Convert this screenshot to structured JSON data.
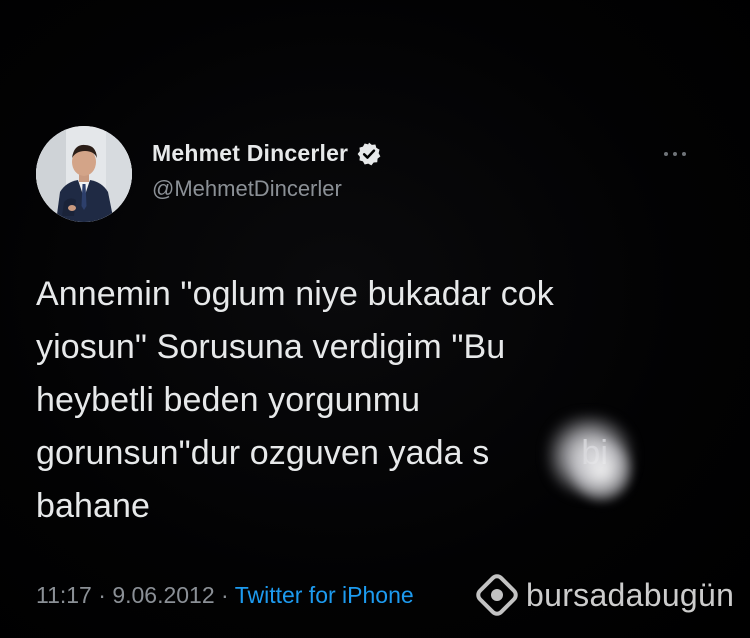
{
  "tweet": {
    "author": {
      "display_name": "Mehmet Dincerler",
      "handle": "@MehmetDincerler",
      "verified": true
    },
    "text_lines": [
      "Annemin \"oglum niye bukadar cok",
      "yiosun\" Sorusuna verdigim \"Bu",
      "heybetli beden yorgunmu",
      "gorunsun\"dur ozguven yada s",
      "bahane"
    ],
    "text_line4_tail": "bi",
    "time": "11:17",
    "date": "9.06.2012",
    "separator": "·",
    "source": "Twitter for iPhone"
  },
  "watermark": {
    "text": "bursadabugün"
  },
  "colors": {
    "background": "#000000",
    "text": "#e7e9ea",
    "secondary": "#8b9096",
    "accent": "#1d9bf0"
  },
  "icons": {
    "verified": "verified-badge-icon",
    "more": "more-options-icon",
    "watermark_logo": "bursadabugun-logo-icon"
  }
}
